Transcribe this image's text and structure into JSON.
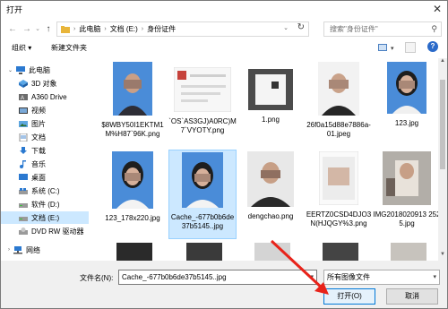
{
  "titlebar": {
    "title": "打开"
  },
  "address": {
    "segments": [
      "此电脑",
      "文档 (E:)",
      "身份证件"
    ]
  },
  "search": {
    "placeholder": "搜索\"身份证件\""
  },
  "toolbar": {
    "organize": "组织 ▾",
    "new_folder": "新建文件夹"
  },
  "sidebar": {
    "items": [
      {
        "label": "此电脑",
        "icon": "computer-icon"
      },
      {
        "label": "3D 对象",
        "icon": "3d-objects-icon"
      },
      {
        "label": "A360 Drive",
        "icon": "cloud-drive-icon"
      },
      {
        "label": "视频",
        "icon": "video-icon"
      },
      {
        "label": "图片",
        "icon": "pictures-icon"
      },
      {
        "label": "文档",
        "icon": "documents-icon"
      },
      {
        "label": "下载",
        "icon": "downloads-icon"
      },
      {
        "label": "音乐",
        "icon": "music-icon"
      },
      {
        "label": "桌面",
        "icon": "desktop-icon"
      },
      {
        "label": "系统 (C:)",
        "icon": "drive-c-icon"
      },
      {
        "label": "软件 (D:)",
        "icon": "drive-d-icon"
      },
      {
        "label": "文档 (E:)",
        "icon": "drive-e-icon"
      },
      {
        "label": "DVD RW 驱动器",
        "icon": "dvd-drive-icon"
      },
      {
        "label": "网络",
        "icon": "network-icon"
      }
    ]
  },
  "files": [
    {
      "name": "$8WBY50I1EKTM1M%H87`96K.png"
    },
    {
      "name": "`OS`AS3GJ)A0RC)M7`VYOTY.png"
    },
    {
      "name": "1.png"
    },
    {
      "name": "26f0a15d88e7886a-01.jpeg"
    },
    {
      "name": "123.jpg"
    },
    {
      "name": "123_178x220.jpg"
    },
    {
      "name": "Cache_-677b0b6de37b5145..jpg"
    },
    {
      "name": "dengchao.png"
    },
    {
      "name": "EERTZ0CSD4DJO3N(HJQGY%3.png"
    },
    {
      "name": "IMG2018020913 2525.jpg"
    }
  ],
  "bottom": {
    "filename_label": "文件名(N):",
    "filename_value": "Cache_-677b0b6de37b5145..jpg",
    "filetype_value": "所有图像文件",
    "open_label": "打开(O)",
    "cancel_label": "取消"
  },
  "colors": {
    "accent": "#0078d7",
    "selection": "#cce8ff",
    "arrow": "#e8231a"
  }
}
